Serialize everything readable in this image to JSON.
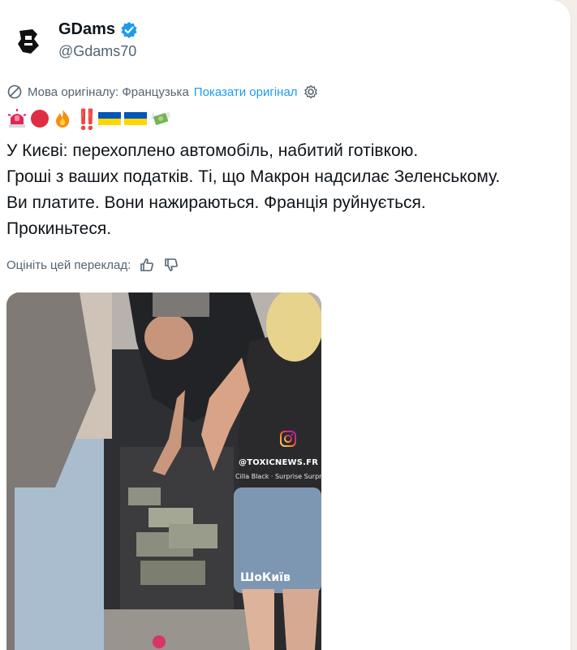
{
  "author": {
    "display_name": "GDams",
    "handle": "@Gdams70",
    "verified": true
  },
  "translation": {
    "original_language_label": "Мова оригіналу: Французька",
    "show_original_label": "Показати оригінал"
  },
  "emojis": [
    "police-light",
    "red-circle",
    "fire",
    "double-exclamation",
    "ukraine-flag",
    "ukraine-flag",
    "money-with-wings"
  ],
  "emoji_glyphs": {
    "double_exclamation": "‼️"
  },
  "tweet": {
    "lines": [
      "У Києві: перехоплено автомобіль, набитий готівкою.",
      "Гроші з ваших податків. Ті, що Макрон надсилає Зеленському.",
      "Ви платите. Вони нажираються. Франція руйнується.",
      "Прокиньтеся."
    ]
  },
  "rate_translation": {
    "label": "Оцініть цей переклад:"
  },
  "media": {
    "watermark_handle": "@TOXICNEWS.FR",
    "watermark_source": "Cilla Black · Surprise Surpr",
    "watermark_brand": "ШоКиїв"
  },
  "colors": {
    "link": "#1d9bf0",
    "secondary_text": "#536471",
    "verified": "#1d9bf0",
    "ukraine_blue": "#0057b7",
    "ukraine_yellow": "#ffd700"
  }
}
